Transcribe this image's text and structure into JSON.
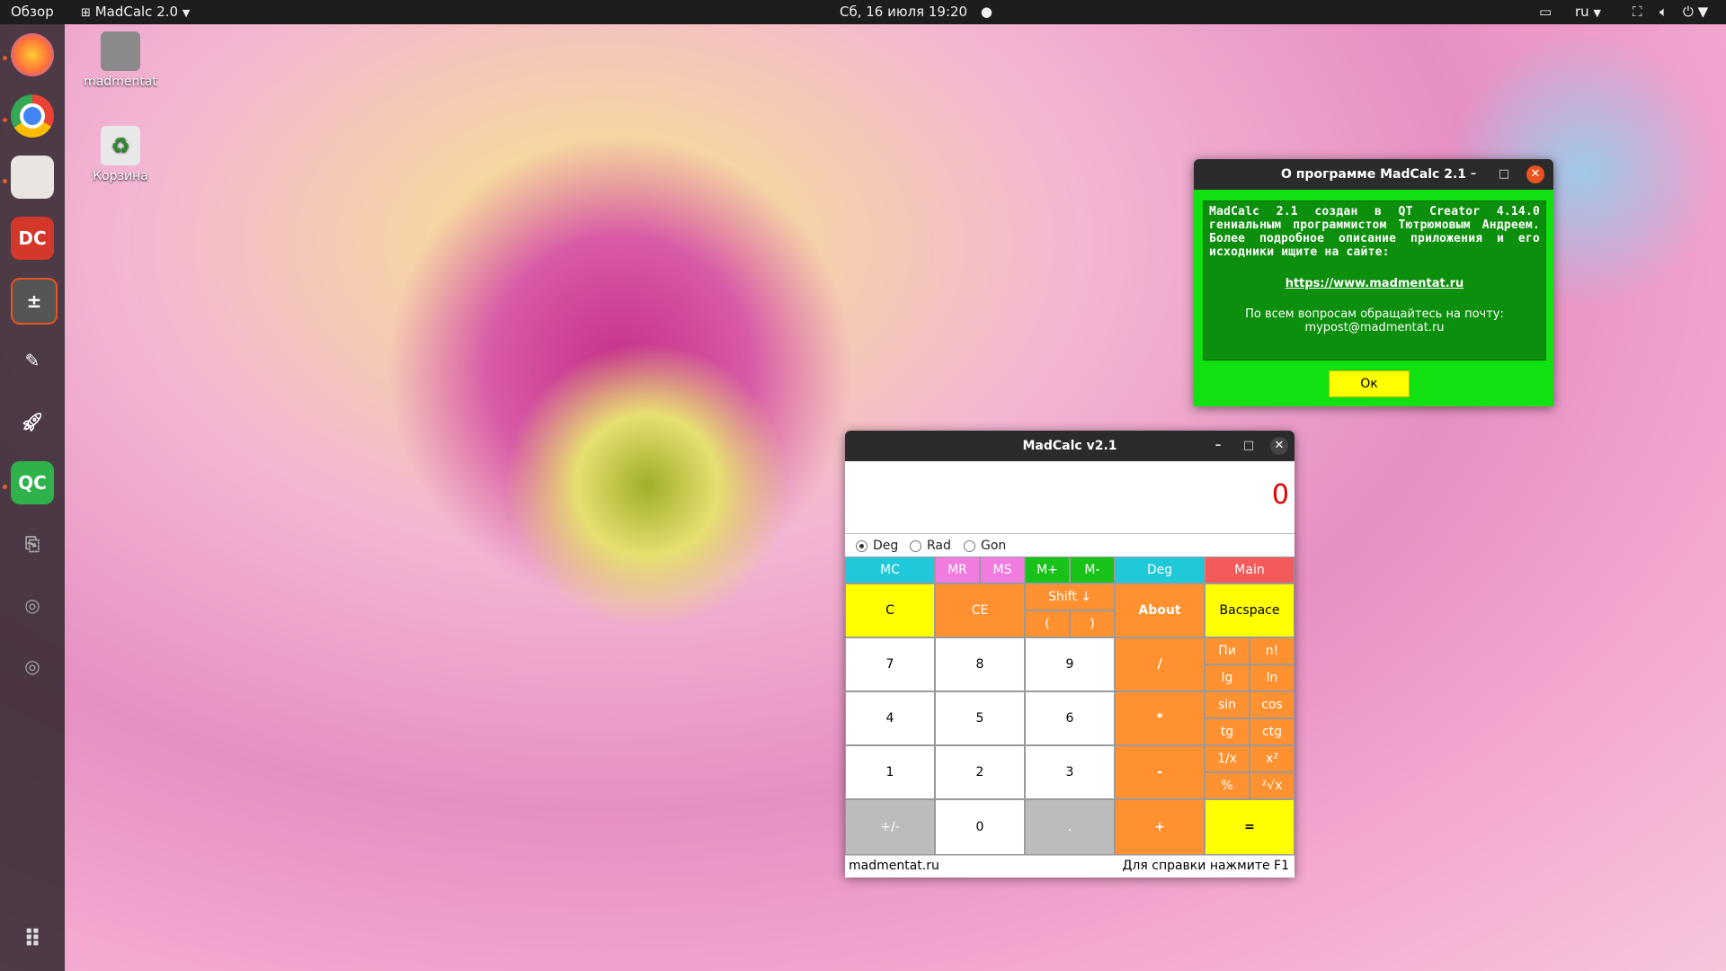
{
  "topbar": {
    "overview": "Обзор",
    "app_name": "MadCalc 2.0",
    "datetime": "Сб, 16 июля  19:20",
    "lang": "ru"
  },
  "desktop": {
    "home_label": "madmentat",
    "trash_label": "Корзина"
  },
  "about": {
    "title": "О программе MadCalc 2.1",
    "text": "MadCalc 2.1 создан в QT Creator 4.14.0 гениальным программистом Тютрюмовым Андреем. Более подробное описание приложения и его исходники ищите на сайте:",
    "link": "https://www.madmentat.ru",
    "mail_line1": "По всем вопросам обращайтесь на почту:",
    "mail_line2": "mypost@madmentat.ru",
    "ok": "Ок"
  },
  "calc": {
    "title": "MadCalc v2.1",
    "display": "0",
    "modes": [
      "Deg",
      "Rad",
      "Gon"
    ],
    "selected_mode": "Deg",
    "buttons": {
      "mc": "MC",
      "mr": "MR",
      "ms": "MS",
      "mplus": "M+",
      "mminus": "M-",
      "deg": "Deg",
      "main": "Main",
      "c": "C",
      "ce": "CE",
      "shift": "Shift ↓",
      "lparen": "(",
      "rparen": ")",
      "about": "About",
      "backspace": "Bacspace",
      "n7": "7",
      "n8": "8",
      "n9": "9",
      "div": "/",
      "n4": "4",
      "n5": "5",
      "n6": "6",
      "mul": "*",
      "n1": "1",
      "n2": "2",
      "n3": "3",
      "sub": "-",
      "sign": "+/-",
      "n0": "0",
      "dot": ".",
      "add": "+",
      "eq": "=",
      "pi": "Пи",
      "fact": "n!",
      "lg": "lg",
      "ln": "ln",
      "sin": "sin",
      "cos": "cos",
      "tg": "tg",
      "ctg": "ctg",
      "inv": "1/x",
      "sq": "x²",
      "pct": "%",
      "sqrt": "²√x"
    },
    "status_left": "madmentat.ru",
    "status_right": "Для справки нажмите F1"
  }
}
